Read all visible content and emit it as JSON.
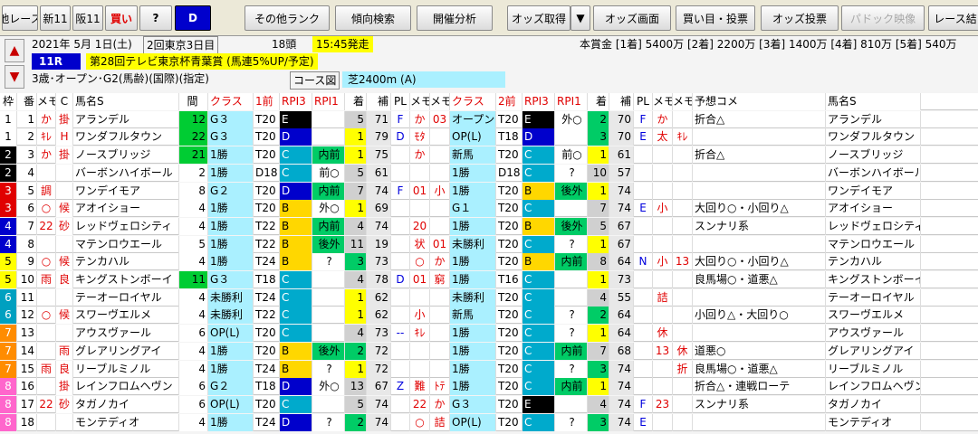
{
  "toolbar": {
    "buttons": [
      "他レース",
      "新11",
      "阪11",
      "買い",
      "?",
      "D",
      "その他ランク",
      "傾向検索",
      "開催分析",
      "オッズ取得",
      "▼",
      "オッズ画面",
      "買い目・投票",
      "オッズ投票",
      "パドック映像",
      "レース結"
    ]
  },
  "race": {
    "date": "2021年 5月 1日(土)",
    "meeting": "2回東京3日目",
    "heads": "18頭",
    "start": "15:45発走",
    "no": "11R",
    "name": "第28回テレビ東京杯青葉賞 (馬連5%UP/予定)",
    "cond": "3歳･オープン･G2(馬齢)(国際)(指定)",
    "course_label": "コース図",
    "course": "芝2400m (A)",
    "prize": "本賞金 [1着] 5400万 [2着] 2200万 [3着] 1400万 [4着] 810万 [5着] 540万"
  },
  "headers": [
    "枠",
    "番",
    "メモ",
    "C",
    "馬名S",
    "間",
    "クラス",
    "1前",
    "RPI3",
    "RPI1",
    "着",
    "補",
    "PL",
    "メモ",
    "メモ",
    "クラス",
    "2前",
    "RPI3",
    "RPI1",
    "着",
    "補",
    "PL",
    "メモ",
    "メモ",
    "予想コメ",
    "馬名S"
  ],
  "colors": {
    "w1": "#ffffff",
    "w2": "#000000",
    "w3": "#e00000",
    "w4": "#0000cc",
    "w5": "#ffff00",
    "w6": "#00a0c0",
    "w7": "#ff8c00",
    "w8": "#ff66cc",
    "cls": "#aaf0ff",
    "rpi3": "#0000cc",
    "rpi1": "#00cc66",
    "pl": "#ff3333"
  },
  "rows": [
    [
      "1",
      "1",
      "か",
      "掛",
      "アランデル",
      "12",
      "G３",
      "T20",
      "E",
      "",
      "5",
      "71",
      "F",
      "か",
      "03",
      "オープン",
      "T20",
      "E",
      "外○",
      "2",
      "70",
      "F",
      "か",
      "",
      "折合△",
      "アランデル"
    ],
    [
      "1",
      "2",
      "ｷﾚ",
      "H",
      "ワンダフルタウン",
      "22",
      "G３",
      "T20",
      "D",
      "",
      "1",
      "79",
      "D",
      "ﾓﾀ",
      "",
      "OP(L)",
      "T18",
      "D",
      "",
      "3",
      "70",
      "E",
      "太",
      "ｷﾚ",
      "",
      "ワンダフルタウン"
    ],
    [
      "2",
      "3",
      "か",
      "掛",
      "ノースブリッジ",
      "21",
      "1勝",
      "T20",
      "C",
      "内前",
      "1",
      "75",
      "",
      "か",
      "",
      "新馬",
      "T20",
      "C",
      "前○",
      "1",
      "61",
      "",
      "",
      "",
      "折合△",
      "ノースブリッジ"
    ],
    [
      "2",
      "4",
      "",
      "",
      "バーボンハイボール",
      "2",
      "1勝",
      "D18",
      "C",
      "前○",
      "5",
      "61",
      "",
      "",
      "",
      "1勝",
      "D18",
      "C",
      "?",
      "10",
      "57",
      "",
      "",
      "",
      "",
      "バーボンハイボール"
    ],
    [
      "3",
      "5",
      "調",
      "",
      "ワンデイモア",
      "8",
      "G２",
      "T20",
      "D",
      "内前",
      "7",
      "74",
      "F",
      "01",
      "小",
      "1勝",
      "T20",
      "B",
      "後外",
      "1",
      "74",
      "",
      "",
      "",
      "",
      "ワンデイモア"
    ],
    [
      "3",
      "6",
      "○",
      "候",
      "アオイショー",
      "4",
      "1勝",
      "T20",
      "B",
      "外○",
      "1",
      "69",
      "",
      "",
      "",
      "G１",
      "T20",
      "C",
      "",
      "7",
      "74",
      "E",
      "小",
      "",
      "大回り○・小回り△",
      "アオイショー"
    ],
    [
      "4",
      "7",
      "22",
      "砂",
      "レッドヴェロシティ",
      "4",
      "1勝",
      "T22",
      "B",
      "内前",
      "4",
      "74",
      "",
      "20",
      "",
      "1勝",
      "T20",
      "B",
      "後外",
      "5",
      "67",
      "",
      "",
      "",
      "スンナリ系",
      "レッドヴェロシティ"
    ],
    [
      "4",
      "8",
      "",
      "",
      "マテンロウエール",
      "5",
      "1勝",
      "T22",
      "B",
      "後外",
      "11",
      "19",
      "",
      "状",
      "01",
      "未勝利",
      "T20",
      "C",
      "?",
      "1",
      "67",
      "",
      "",
      "",
      "",
      "マテンロウエール"
    ],
    [
      "5",
      "9",
      "○",
      "候",
      "テンカハル",
      "4",
      "1勝",
      "T24",
      "B",
      "?",
      "3",
      "73",
      "",
      "○",
      "か",
      "1勝",
      "T20",
      "B",
      "内前",
      "8",
      "64",
      "N",
      "小",
      "13",
      "大回り○・小回り△",
      "テンカハル"
    ],
    [
      "5",
      "10",
      "雨",
      "良",
      "キングストンボーイ",
      "11",
      "G３",
      "T18",
      "C",
      "",
      "4",
      "78",
      "D",
      "01",
      "窮",
      "1勝",
      "T16",
      "C",
      "",
      "1",
      "73",
      "",
      "",
      "",
      "良馬場○・道悪△",
      "キングストンボーイ"
    ],
    [
      "6",
      "11",
      "",
      "",
      "テーオーロイヤル",
      "4",
      "未勝利",
      "T24",
      "C",
      "",
      "1",
      "62",
      "",
      "",
      "",
      "未勝利",
      "T20",
      "C",
      "",
      "4",
      "55",
      "",
      "詰",
      "",
      "",
      "テーオーロイヤル"
    ],
    [
      "6",
      "12",
      "○",
      "候",
      "スワーヴエルメ",
      "4",
      "未勝利",
      "T22",
      "C",
      "",
      "1",
      "62",
      "",
      "小",
      "",
      "新馬",
      "T20",
      "C",
      "?",
      "2",
      "64",
      "",
      "",
      "",
      "小回り△・大回り○",
      "スワーヴエルメ"
    ],
    [
      "7",
      "13",
      "",
      "",
      "アウスヴァール",
      "6",
      "OP(L)",
      "T20",
      "C",
      "",
      "4",
      "73",
      "--",
      "ｷﾚ",
      "",
      "1勝",
      "T20",
      "C",
      "?",
      "1",
      "64",
      "",
      "休",
      "",
      "",
      "アウスヴァール"
    ],
    [
      "7",
      "14",
      "",
      "雨",
      "グレアリングアイ",
      "4",
      "1勝",
      "T20",
      "B",
      "後外",
      "2",
      "72",
      "",
      "",
      "",
      "1勝",
      "T20",
      "C",
      "内前",
      "7",
      "68",
      "",
      "13",
      "休",
      "道悪○",
      "グレアリングアイ"
    ],
    [
      "7",
      "15",
      "雨",
      "良",
      "リーブルミノル",
      "4",
      "1勝",
      "T24",
      "B",
      "?",
      "1",
      "72",
      "",
      "",
      "",
      "1勝",
      "T20",
      "C",
      "?",
      "3",
      "74",
      "",
      "",
      "折",
      "良馬場○・道悪△",
      "リーブルミノル"
    ],
    [
      "8",
      "16",
      "",
      "掛",
      "レインフロムヘヴン",
      "6",
      "G２",
      "T18",
      "D",
      "外○",
      "13",
      "67",
      "Z",
      "難",
      "ﾄﾃ",
      "1勝",
      "T20",
      "C",
      "内前",
      "1",
      "74",
      "",
      "",
      "",
      "折合△・連戦ローテ",
      "レインフロムヘヴン"
    ],
    [
      "8",
      "17",
      "22",
      "砂",
      "タガノカイ",
      "6",
      "OP(L)",
      "T20",
      "C",
      "",
      "5",
      "74",
      "",
      "22",
      "か",
      "G３",
      "T20",
      "E",
      "",
      "4",
      "74",
      "F",
      "23",
      "",
      "スンナリ系",
      "タガノカイ"
    ],
    [
      "8",
      "18",
      "",
      "",
      "モンテディオ",
      "4",
      "1勝",
      "T24",
      "D",
      "?",
      "2",
      "74",
      "",
      "○",
      "詰",
      "OP(L)",
      "T20",
      "C",
      "?",
      "3",
      "74",
      "E",
      "",
      "",
      "",
      "モンテディオ"
    ]
  ]
}
